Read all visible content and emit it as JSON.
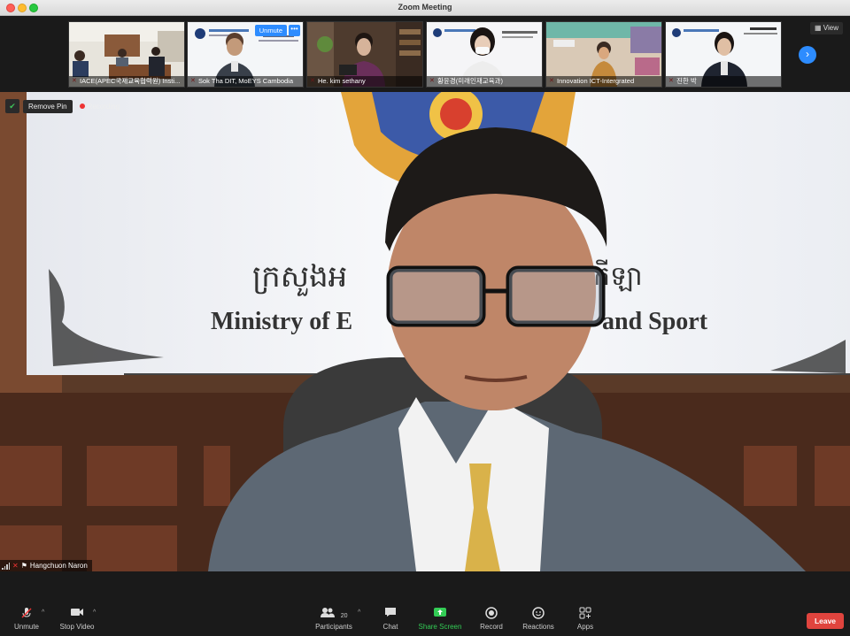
{
  "window": {
    "title": "Zoom Meeting"
  },
  "strip": {
    "participants": [
      {
        "name": "IACE(APEC국제교육협력원) Insti..."
      },
      {
        "name": "Sok Tha DIT, MoEYS Cambodia"
      },
      {
        "name": "He. kim sethany"
      },
      {
        "name": "황윤경(미래인재교육과)"
      },
      {
        "name": "Innovation ICT-Intergrated"
      },
      {
        "name": "진한 박"
      }
    ],
    "unmute_label": "Unmute",
    "more_label": "•••",
    "view_label": "View"
  },
  "main": {
    "remove_pin_label": "Remove Pin",
    "recording_label": "Recording",
    "speaker_name": "Hangchuon Naron",
    "banner_khmer": "ក្រសួងអ",
    "banner_khmer_right": "កីឡា",
    "banner_english_left": "Ministry of E",
    "banner_english_right": "and Sport"
  },
  "controls": {
    "unmute": "Unmute",
    "stop_video": "Stop Video",
    "participants": "Participants",
    "participants_count": "20",
    "chat": "Chat",
    "share_screen": "Share Screen",
    "record": "Record",
    "reactions": "Reactions",
    "apps": "Apps",
    "leave": "Leave"
  }
}
